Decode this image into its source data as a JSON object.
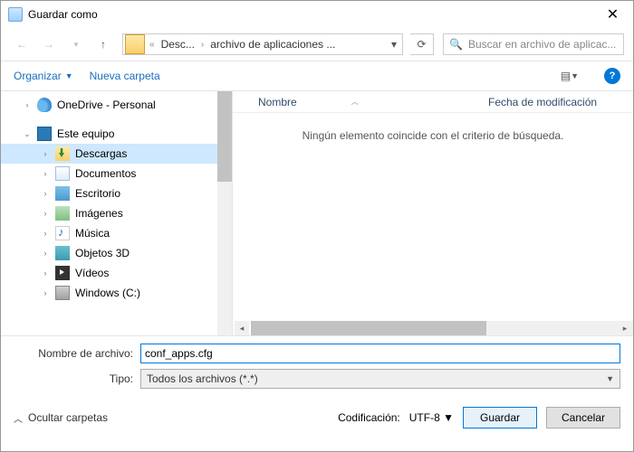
{
  "window": {
    "title": "Guardar como"
  },
  "nav": {
    "crumb1": "Desc...",
    "crumb2": "archivo de aplicaciones ...",
    "search_placeholder": "Buscar en archivo de aplicac..."
  },
  "toolbar": {
    "organize": "Organizar",
    "new_folder": "Nueva carpeta",
    "help": "?"
  },
  "tree": {
    "items": [
      {
        "label": "OneDrive - Personal",
        "icon": "onedrive",
        "indent": false,
        "expandable": true,
        "selected": false
      },
      {
        "label": "Este equipo",
        "icon": "thispc",
        "indent": false,
        "expandable": true,
        "selected": false
      },
      {
        "label": "Descargas",
        "icon": "dl",
        "indent": true,
        "expandable": true,
        "selected": true
      },
      {
        "label": "Documentos",
        "icon": "doc",
        "indent": true,
        "expandable": true,
        "selected": false
      },
      {
        "label": "Escritorio",
        "icon": "desk",
        "indent": true,
        "expandable": true,
        "selected": false
      },
      {
        "label": "Imágenes",
        "icon": "img",
        "indent": true,
        "expandable": true,
        "selected": false
      },
      {
        "label": "Música",
        "icon": "music",
        "indent": true,
        "expandable": true,
        "selected": false
      },
      {
        "label": "Objetos 3D",
        "icon": "3d",
        "indent": true,
        "expandable": true,
        "selected": false
      },
      {
        "label": "Vídeos",
        "icon": "vid",
        "indent": true,
        "expandable": true,
        "selected": false
      },
      {
        "label": "Windows (C:)",
        "icon": "drive",
        "indent": true,
        "expandable": true,
        "selected": false
      }
    ]
  },
  "list": {
    "col_name": "Nombre",
    "col_date": "Fecha de modificación",
    "empty_msg": "Ningún elemento coincide con el criterio de búsqueda."
  },
  "form": {
    "filename_label": "Nombre de archivo:",
    "filename_value": "conf_apps.cfg",
    "type_label": "Tipo:",
    "type_value": "Todos los archivos  (*.*)",
    "encoding_label": "Codificación:",
    "encoding_value": "UTF-8"
  },
  "footer": {
    "hide_folders": "Ocultar carpetas",
    "save": "Guardar",
    "cancel": "Cancelar"
  }
}
